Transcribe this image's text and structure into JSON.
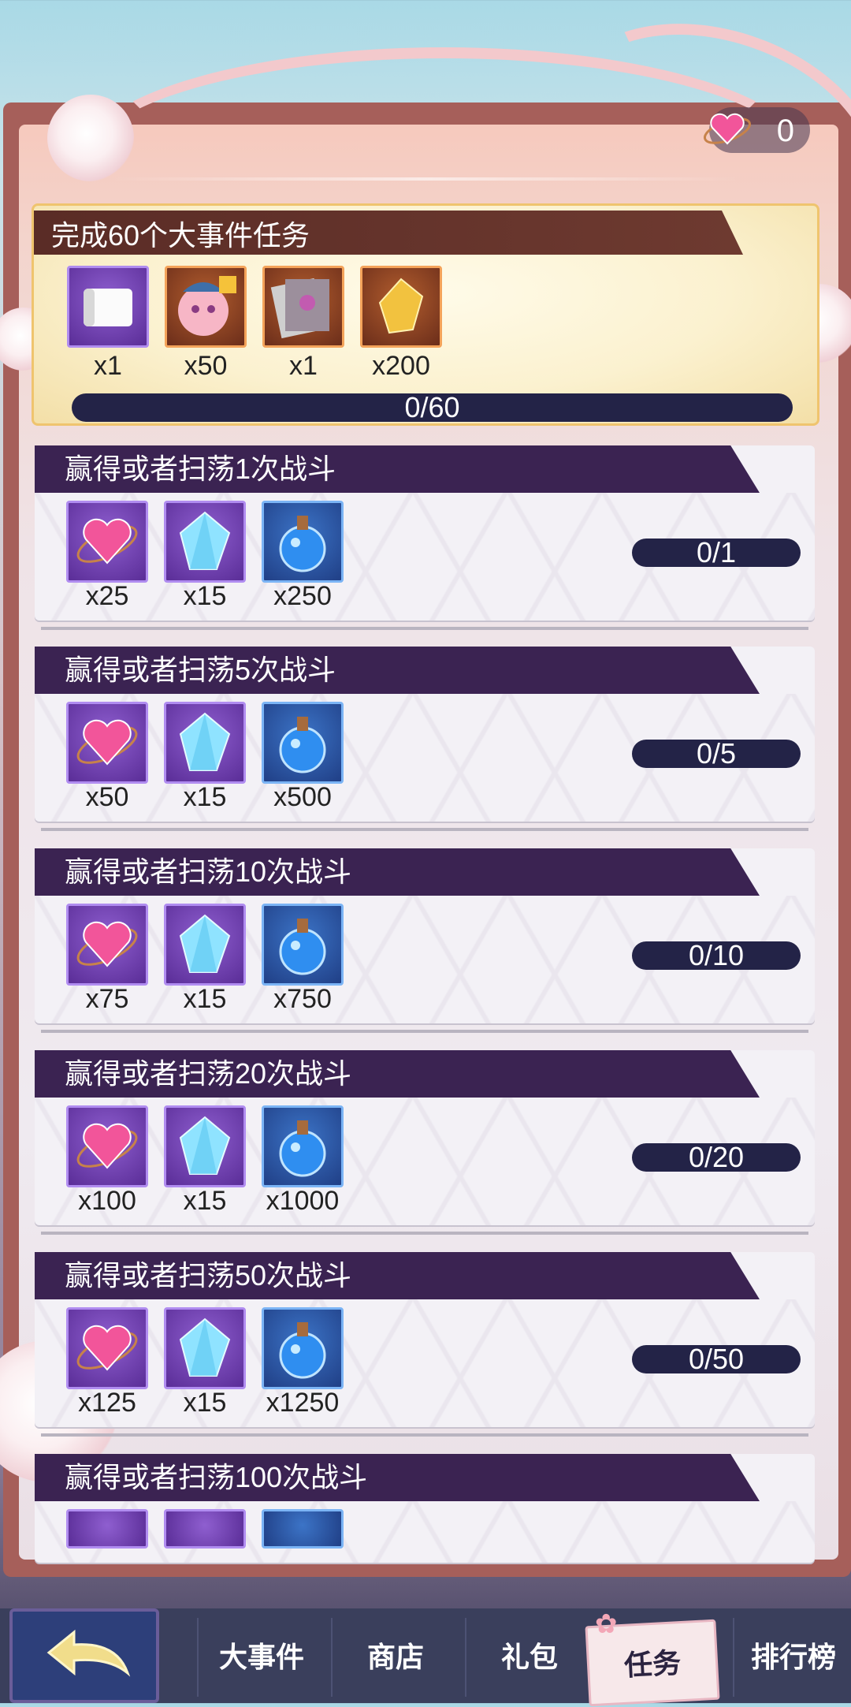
{
  "header": {
    "currency_count": "0",
    "currency_icon": "heart-orb-icon"
  },
  "featured_task": {
    "title": "完成60个大事件任务",
    "rewards": [
      {
        "icon": "scroll-icon",
        "qty": "x1",
        "frame": "purple"
      },
      {
        "icon": "character-fragment-icon",
        "qty": "x50",
        "frame": "orange"
      },
      {
        "icon": "card-pack-icon",
        "qty": "x1",
        "frame": "orange"
      },
      {
        "icon": "gold-crystal-icon",
        "qty": "x200",
        "frame": "orange"
      }
    ],
    "progress": "0/60",
    "progress_fraction": 0
  },
  "tasks": [
    {
      "title": "赢得或者扫荡1次战斗",
      "rewards": [
        "x25",
        "x15",
        "x250"
      ],
      "progress": "0/1"
    },
    {
      "title": "赢得或者扫荡5次战斗",
      "rewards": [
        "x50",
        "x15",
        "x500"
      ],
      "progress": "0/5"
    },
    {
      "title": "赢得或者扫荡10次战斗",
      "rewards": [
        "x75",
        "x15",
        "x750"
      ],
      "progress": "0/10"
    },
    {
      "title": "赢得或者扫荡20次战斗",
      "rewards": [
        "x100",
        "x15",
        "x1000"
      ],
      "progress": "0/20"
    },
    {
      "title": "赢得或者扫荡50次战斗",
      "rewards": [
        "x125",
        "x15",
        "x1250"
      ],
      "progress": "0/50"
    },
    {
      "title": "赢得或者扫荡100次战斗"
    }
  ],
  "task_reward_icons": [
    "heart-orb-icon",
    "blue-crystal-icon",
    "blue-potion-icon"
  ],
  "nav": {
    "back_icon": "back-arrow-icon",
    "tabs": [
      "大事件",
      "商店",
      "礼包",
      "任务",
      "排行榜"
    ],
    "active": "任务"
  },
  "colors": {
    "title_bar": "#3b2352",
    "progress_bar": "#232347",
    "featured_border": "#efc46e"
  }
}
